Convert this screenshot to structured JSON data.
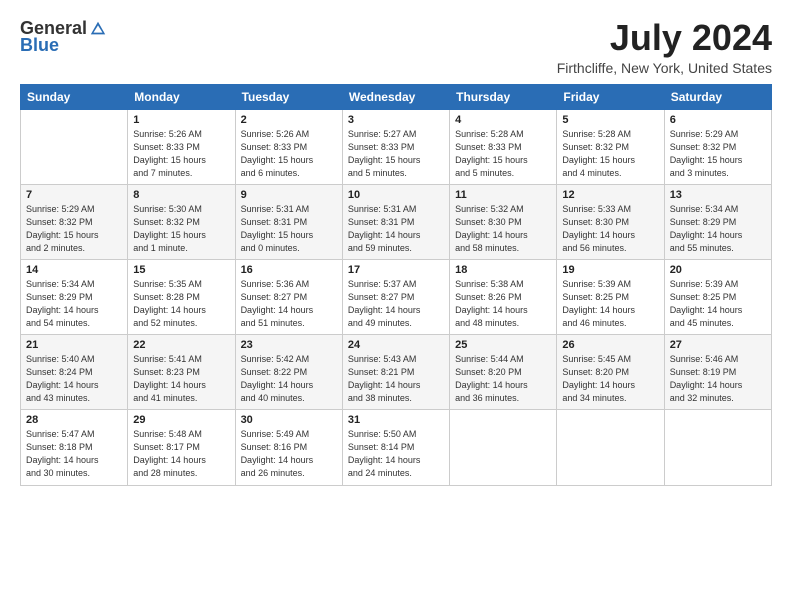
{
  "header": {
    "logo_general": "General",
    "logo_blue": "Blue",
    "month_title": "July 2024",
    "location": "Firthcliffe, New York, United States"
  },
  "days_of_week": [
    "Sunday",
    "Monday",
    "Tuesday",
    "Wednesday",
    "Thursday",
    "Friday",
    "Saturday"
  ],
  "weeks": [
    [
      {
        "day": "",
        "info": ""
      },
      {
        "day": "1",
        "info": "Sunrise: 5:26 AM\nSunset: 8:33 PM\nDaylight: 15 hours\nand 7 minutes."
      },
      {
        "day": "2",
        "info": "Sunrise: 5:26 AM\nSunset: 8:33 PM\nDaylight: 15 hours\nand 6 minutes."
      },
      {
        "day": "3",
        "info": "Sunrise: 5:27 AM\nSunset: 8:33 PM\nDaylight: 15 hours\nand 5 minutes."
      },
      {
        "day": "4",
        "info": "Sunrise: 5:28 AM\nSunset: 8:33 PM\nDaylight: 15 hours\nand 5 minutes."
      },
      {
        "day": "5",
        "info": "Sunrise: 5:28 AM\nSunset: 8:32 PM\nDaylight: 15 hours\nand 4 minutes."
      },
      {
        "day": "6",
        "info": "Sunrise: 5:29 AM\nSunset: 8:32 PM\nDaylight: 15 hours\nand 3 minutes."
      }
    ],
    [
      {
        "day": "7",
        "info": "Sunrise: 5:29 AM\nSunset: 8:32 PM\nDaylight: 15 hours\nand 2 minutes."
      },
      {
        "day": "8",
        "info": "Sunrise: 5:30 AM\nSunset: 8:32 PM\nDaylight: 15 hours\nand 1 minute."
      },
      {
        "day": "9",
        "info": "Sunrise: 5:31 AM\nSunset: 8:31 PM\nDaylight: 15 hours\nand 0 minutes."
      },
      {
        "day": "10",
        "info": "Sunrise: 5:31 AM\nSunset: 8:31 PM\nDaylight: 14 hours\nand 59 minutes."
      },
      {
        "day": "11",
        "info": "Sunrise: 5:32 AM\nSunset: 8:30 PM\nDaylight: 14 hours\nand 58 minutes."
      },
      {
        "day": "12",
        "info": "Sunrise: 5:33 AM\nSunset: 8:30 PM\nDaylight: 14 hours\nand 56 minutes."
      },
      {
        "day": "13",
        "info": "Sunrise: 5:34 AM\nSunset: 8:29 PM\nDaylight: 14 hours\nand 55 minutes."
      }
    ],
    [
      {
        "day": "14",
        "info": "Sunrise: 5:34 AM\nSunset: 8:29 PM\nDaylight: 14 hours\nand 54 minutes."
      },
      {
        "day": "15",
        "info": "Sunrise: 5:35 AM\nSunset: 8:28 PM\nDaylight: 14 hours\nand 52 minutes."
      },
      {
        "day": "16",
        "info": "Sunrise: 5:36 AM\nSunset: 8:27 PM\nDaylight: 14 hours\nand 51 minutes."
      },
      {
        "day": "17",
        "info": "Sunrise: 5:37 AM\nSunset: 8:27 PM\nDaylight: 14 hours\nand 49 minutes."
      },
      {
        "day": "18",
        "info": "Sunrise: 5:38 AM\nSunset: 8:26 PM\nDaylight: 14 hours\nand 48 minutes."
      },
      {
        "day": "19",
        "info": "Sunrise: 5:39 AM\nSunset: 8:25 PM\nDaylight: 14 hours\nand 46 minutes."
      },
      {
        "day": "20",
        "info": "Sunrise: 5:39 AM\nSunset: 8:25 PM\nDaylight: 14 hours\nand 45 minutes."
      }
    ],
    [
      {
        "day": "21",
        "info": "Sunrise: 5:40 AM\nSunset: 8:24 PM\nDaylight: 14 hours\nand 43 minutes."
      },
      {
        "day": "22",
        "info": "Sunrise: 5:41 AM\nSunset: 8:23 PM\nDaylight: 14 hours\nand 41 minutes."
      },
      {
        "day": "23",
        "info": "Sunrise: 5:42 AM\nSunset: 8:22 PM\nDaylight: 14 hours\nand 40 minutes."
      },
      {
        "day": "24",
        "info": "Sunrise: 5:43 AM\nSunset: 8:21 PM\nDaylight: 14 hours\nand 38 minutes."
      },
      {
        "day": "25",
        "info": "Sunrise: 5:44 AM\nSunset: 8:20 PM\nDaylight: 14 hours\nand 36 minutes."
      },
      {
        "day": "26",
        "info": "Sunrise: 5:45 AM\nSunset: 8:20 PM\nDaylight: 14 hours\nand 34 minutes."
      },
      {
        "day": "27",
        "info": "Sunrise: 5:46 AM\nSunset: 8:19 PM\nDaylight: 14 hours\nand 32 minutes."
      }
    ],
    [
      {
        "day": "28",
        "info": "Sunrise: 5:47 AM\nSunset: 8:18 PM\nDaylight: 14 hours\nand 30 minutes."
      },
      {
        "day": "29",
        "info": "Sunrise: 5:48 AM\nSunset: 8:17 PM\nDaylight: 14 hours\nand 28 minutes."
      },
      {
        "day": "30",
        "info": "Sunrise: 5:49 AM\nSunset: 8:16 PM\nDaylight: 14 hours\nand 26 minutes."
      },
      {
        "day": "31",
        "info": "Sunrise: 5:50 AM\nSunset: 8:14 PM\nDaylight: 14 hours\nand 24 minutes."
      },
      {
        "day": "",
        "info": ""
      },
      {
        "day": "",
        "info": ""
      },
      {
        "day": "",
        "info": ""
      }
    ]
  ]
}
